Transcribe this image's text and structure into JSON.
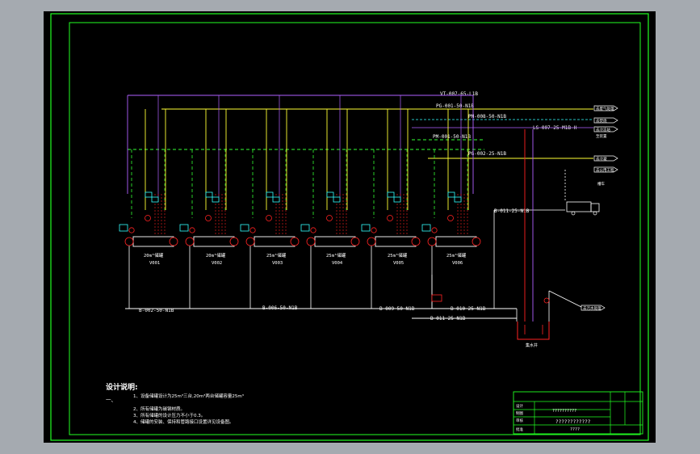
{
  "colors": {
    "background": "#000000",
    "frame": "#22ff22",
    "purple": "#b060ff",
    "yellow": "#ffff33",
    "green_dash": "#33ff33",
    "red": "#ff2222",
    "cyan": "#33ffff",
    "white": "#ffffff",
    "window_bg": "#a5aab0"
  },
  "pipe_labels": {
    "top_vent": "VT-007-65-L1B",
    "pg": "PG-001-50-N1B",
    "pm_vent": "PM-008-50-N1B",
    "pm_feed": "PM-001-50-N1B",
    "pg_return": "PG-002-25-N1B",
    "ls": "LS-007-25-M1B-H",
    "b_right": "B-011-25-N1B",
    "b_main_1": "B-002-50-N1B",
    "b_main_2": "B-006-50-N1B",
    "b_main_3": "B-009-50-N1B",
    "b_low_1": "B-010-25-N1B",
    "b_low_2": "B-011-25-N1B"
  },
  "tanks": [
    {
      "label": "20m³储罐",
      "tag": "V001"
    },
    {
      "label": "20m³储罐",
      "tag": "V002"
    },
    {
      "label": "25m³储罐",
      "tag": "V003"
    },
    {
      "label": "25m³储罐",
      "tag": "V004"
    },
    {
      "label": "25m³储罐",
      "tag": "V005"
    },
    {
      "label": "25m³储罐",
      "tag": "V006"
    }
  ],
  "outlets": [
    {
      "label": "去废气处理"
    },
    {
      "label": "去焚烧"
    },
    {
      "label": "去冷冻站"
    },
    {
      "label": "去冷凝"
    },
    {
      "label": "去公用工程"
    },
    {
      "label": "至装置"
    }
  ],
  "truck_label": "槽车",
  "pit_label": "集水井",
  "right_outlet": "去污水处理",
  "notes": {
    "title": "设计说明:",
    "section": "一、",
    "items": [
      "1、设备储罐设计为25m³三台,20m³两台储罐容量25m³",
      "2、所有储罐为碳钢材质。",
      "3、所有储罐的设计压力不小于0.3。",
      "4、储罐的安装、保持和管路接口设置详见设备图。"
    ]
  },
  "title_block": {
    "row_labels": [
      "设计",
      "制图",
      "审核",
      "批准"
    ],
    "drawing_no": "??????????",
    "drawing_name": "????????????",
    "scale": "????"
  }
}
